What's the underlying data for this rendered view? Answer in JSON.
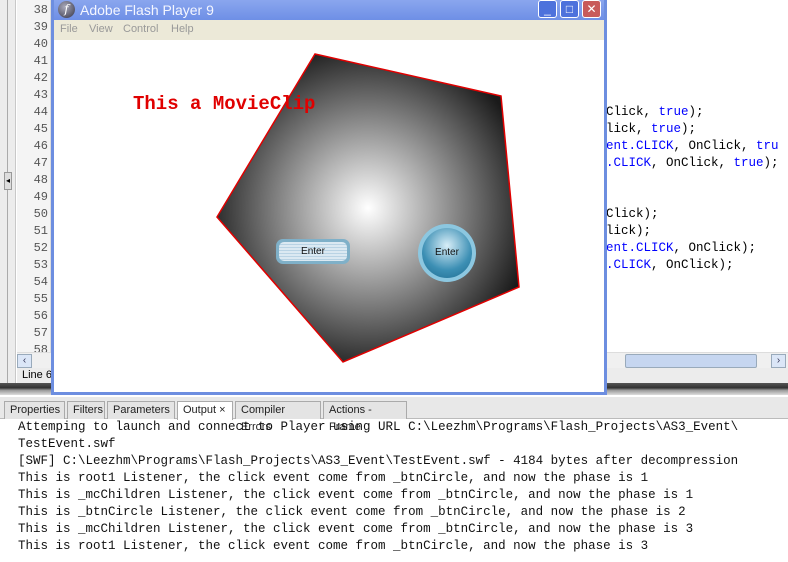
{
  "editor": {
    "line_numbers": [
      "38",
      "39",
      "40",
      "41",
      "42",
      "43",
      "44",
      "45",
      "46",
      "47",
      "48",
      "49",
      "50",
      "51",
      "52",
      "53",
      "54",
      "55",
      "56",
      "57",
      "58"
    ],
    "code_lines": [
      {
        "line": "44",
        "parts": [
          {
            "t": "Click, ",
            "k": false
          },
          {
            "t": "true",
            "k": true
          },
          {
            "t": ");",
            "k": false
          }
        ]
      },
      {
        "line": "45",
        "parts": [
          {
            "t": "lick, ",
            "k": false
          },
          {
            "t": "true",
            "k": true
          },
          {
            "t": ");",
            "k": false
          }
        ]
      },
      {
        "line": "46",
        "parts": [
          {
            "t": "ent.CLICK",
            "k": true
          },
          {
            "t": ", OnClick, ",
            "k": false
          },
          {
            "t": "tru",
            "k": true
          }
        ]
      },
      {
        "line": "47",
        "parts": [
          {
            "t": ".CLICK",
            "k": true
          },
          {
            "t": ", OnClick, ",
            "k": false
          },
          {
            "t": "true",
            "k": true
          },
          {
            "t": ");",
            "k": false
          }
        ]
      },
      {
        "line": "50",
        "parts": [
          {
            "t": "Click);",
            "k": false
          }
        ]
      },
      {
        "line": "51",
        "parts": [
          {
            "t": "lick);",
            "k": false
          }
        ]
      },
      {
        "line": "52",
        "parts": [
          {
            "t": "ent.CLICK",
            "k": true
          },
          {
            "t": ", OnClick);",
            "k": false
          }
        ]
      },
      {
        "line": "53",
        "parts": [
          {
            "t": ".CLICK",
            "k": true
          },
          {
            "t": ", OnClick);",
            "k": false
          }
        ]
      }
    ],
    "status": "Line 6"
  },
  "flash_window": {
    "title": "Adobe Flash Player 9",
    "menu": [
      "File",
      "View",
      "Control",
      "Help"
    ],
    "movieclip_text": "This a MovieClip",
    "rect_button_label": "Enter",
    "circle_button_label": "Enter",
    "pentagon_colors": {
      "center": "#ffffff",
      "edge": "#1a1a1a",
      "stroke": "#e00000"
    }
  },
  "panel": {
    "tabs": [
      {
        "label": "Properties"
      },
      {
        "label": "Filters"
      },
      {
        "label": "Parameters"
      },
      {
        "label": "Output ×",
        "active": true
      },
      {
        "label": "Compiler Errors"
      },
      {
        "label": "Actions - Frame"
      }
    ],
    "output": [
      "Attemping to launch and connect to Player using URL C:\\Leezhm\\Programs\\Flash_Projects\\AS3_Event\\",
      "TestEvent.swf",
      "[SWF] C:\\Leezhm\\Programs\\Flash_Projects\\AS3_Event\\TestEvent.swf - 4184 bytes after decompression",
      "This is root1 Listener, the click event come from _btnCircle, and now the phase is 1",
      "This is _mcChildren Listener, the click event come from _btnCircle, and now the phase is 1",
      "This is _btnCircle Listener, the click event come from _btnCircle, and now the phase is 2",
      "This is _mcChildren Listener, the click event come from _btnCircle, and now the phase is 3",
      "This is root1 Listener, the click event come from _btnCircle, and now the phase is 3"
    ]
  }
}
